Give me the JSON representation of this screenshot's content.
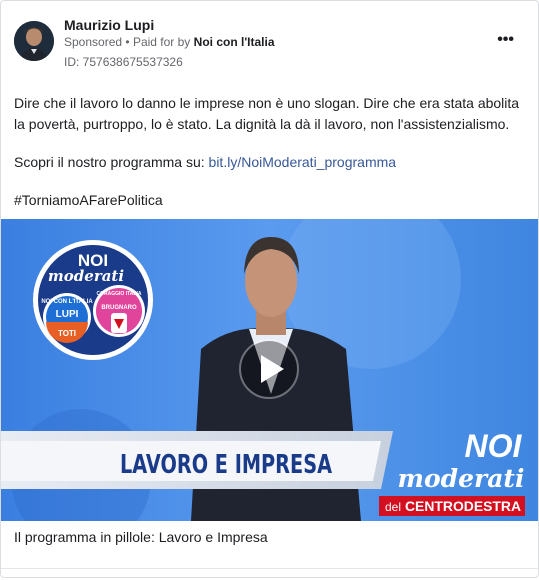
{
  "post": {
    "author_name": "Maurizio Lupi",
    "sponsored_label": "Sponsored",
    "paid_by_prefix": "Paid for by",
    "paid_by_name": "Noi con l'Italia",
    "separator": "•",
    "ad_id": "ID: 757638675537326",
    "more_icon": "•••",
    "text_line1": "Dire che il lavoro lo danno le imprese non è uno slogan. Dire che era stata abolita la povertà, purtroppo, lo è stato. La dignità la dà il lavoro, non l'assistenzialismo.",
    "cta_prefix": "Scopri il nostro programma su: ",
    "cta_link": "bit.ly/NoiModerati_programma",
    "hashtag": "#TorniamoAFarePolitica",
    "caption": "Il programma in pillole: Lavoro e Impresa"
  },
  "video": {
    "banner_text": "LAVORO E IMPRESA",
    "logo_noi": "NOI",
    "logo_moderati": "moderati",
    "logo_noi_italia": "NOI CON L'ITALIA",
    "logo_lupi": "LUPI",
    "logo_toti": "TOTI",
    "logo_coraggio": "CORAGGIO ITALIA",
    "logo_brugnaro": "BRUGNARO",
    "brand_noi": "NOI",
    "brand_moderati": "moderati",
    "brand_del": "del",
    "brand_centrodestra": "CENTRODESTRA",
    "colors": {
      "background": "#3f86e0",
      "banner_red": "#d3101f",
      "logo_navy": "#1a3a8a"
    }
  }
}
